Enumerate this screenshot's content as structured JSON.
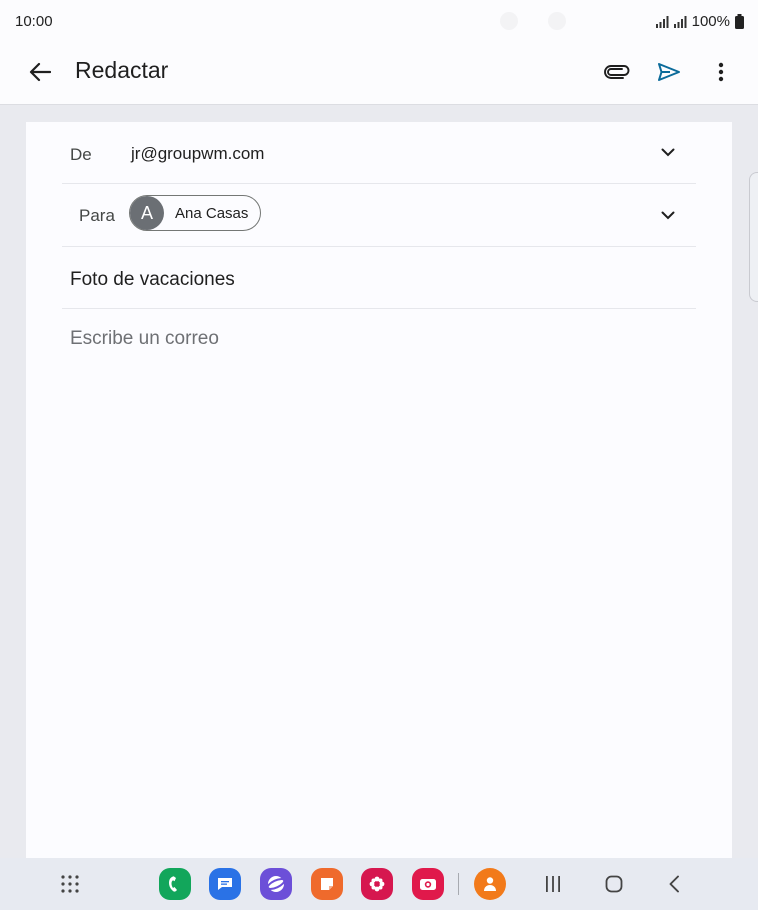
{
  "status_bar": {
    "time": "10:00",
    "battery": "100%"
  },
  "app_bar": {
    "title": "Redactar",
    "icons": [
      "back-arrow-icon",
      "paperclip-icon",
      "send-icon",
      "more-vert-icon"
    ]
  },
  "compose": {
    "from_label": "De",
    "from_value": "jr@groupwm.com",
    "to_label": "Para",
    "recipient": {
      "initial": "A",
      "name": "Ana Casas"
    },
    "subject": "Foto de vacaciones",
    "body_placeholder": "Escribe un correo"
  },
  "navbar": {
    "apps": [
      "apps-grid-icon",
      "phone-icon",
      "messages-icon",
      "internet-icon",
      "notes-icon",
      "gallery-icon",
      "camera-icon",
      "contacts-icon"
    ],
    "buttons": [
      "recents-icon",
      "home-icon",
      "back-icon"
    ]
  },
  "colors": {
    "accent": "#0b6b9a",
    "sheet_bg": "#fcfcff",
    "page_bg": "#e9eaef"
  }
}
